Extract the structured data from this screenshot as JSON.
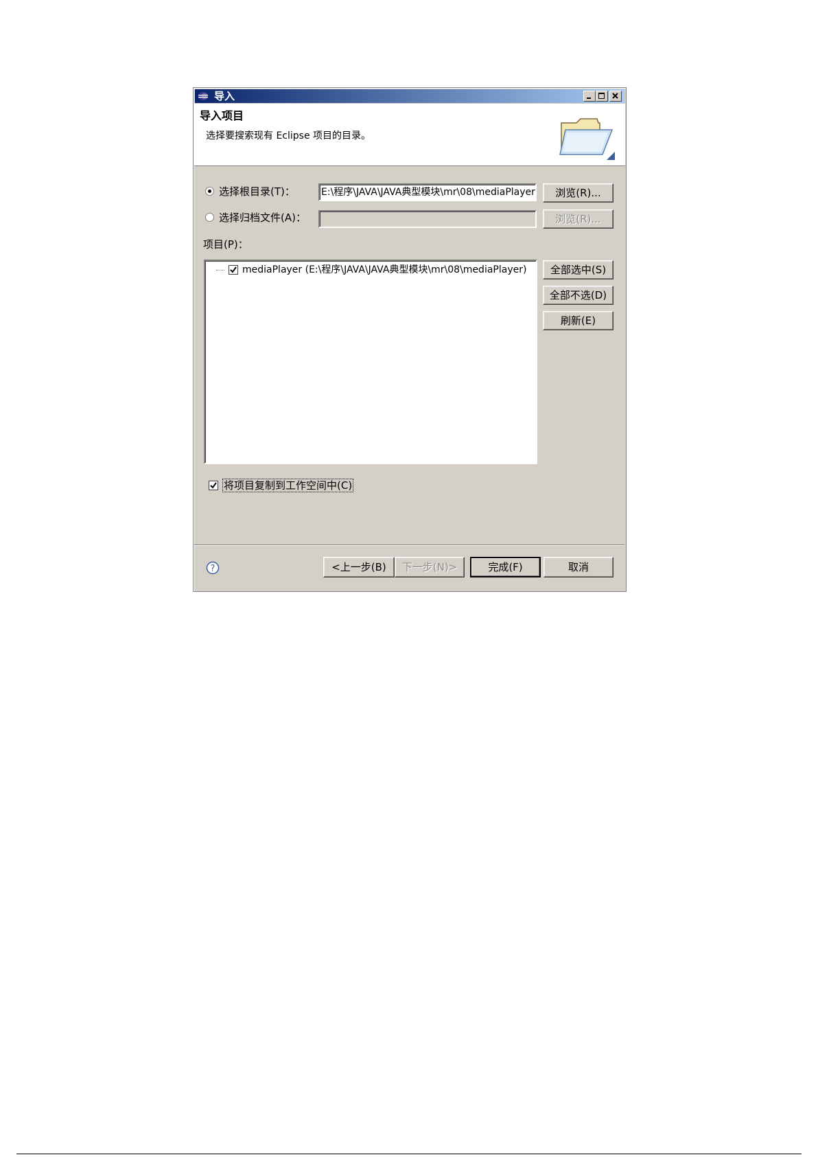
{
  "window": {
    "title": "导入",
    "controls": [
      "minimize-icon",
      "maximize-icon",
      "close-icon"
    ]
  },
  "banner": {
    "title": "导入项目",
    "description": "选择要搜索现有 Eclipse 项目的目录。",
    "icon": "folder-icon"
  },
  "source": {
    "root_radio_label": "选择根目录(T)：",
    "root_path_value": "E:\\程序\\JAVA\\JAVA典型模块\\mr\\08\\mediaPlayer",
    "browse_root_label": "浏览(R)...",
    "archive_radio_label": "选择归档文件(A)：",
    "archive_path_value": "",
    "browse_archive_label": "浏览(R)...",
    "selected": "root"
  },
  "projects": {
    "label": "项目(P)：",
    "items": [
      {
        "label": "mediaPlayer (E:\\程序\\JAVA\\JAVA典型模块\\mr\\08\\mediaPlayer)",
        "checked": true
      }
    ],
    "select_all_label": "全部选中(S)",
    "deselect_all_label": "全部不选(D)",
    "refresh_label": "刷新(E)"
  },
  "options": {
    "copy_label": "将项目复制到工作空间中(C)",
    "copy_checked": true
  },
  "footer": {
    "help_icon": "help-icon",
    "back_label": "<上一步(B)",
    "next_label": "下一步(N)>",
    "finish_label": "完成(F)",
    "cancel_label": "取消"
  }
}
